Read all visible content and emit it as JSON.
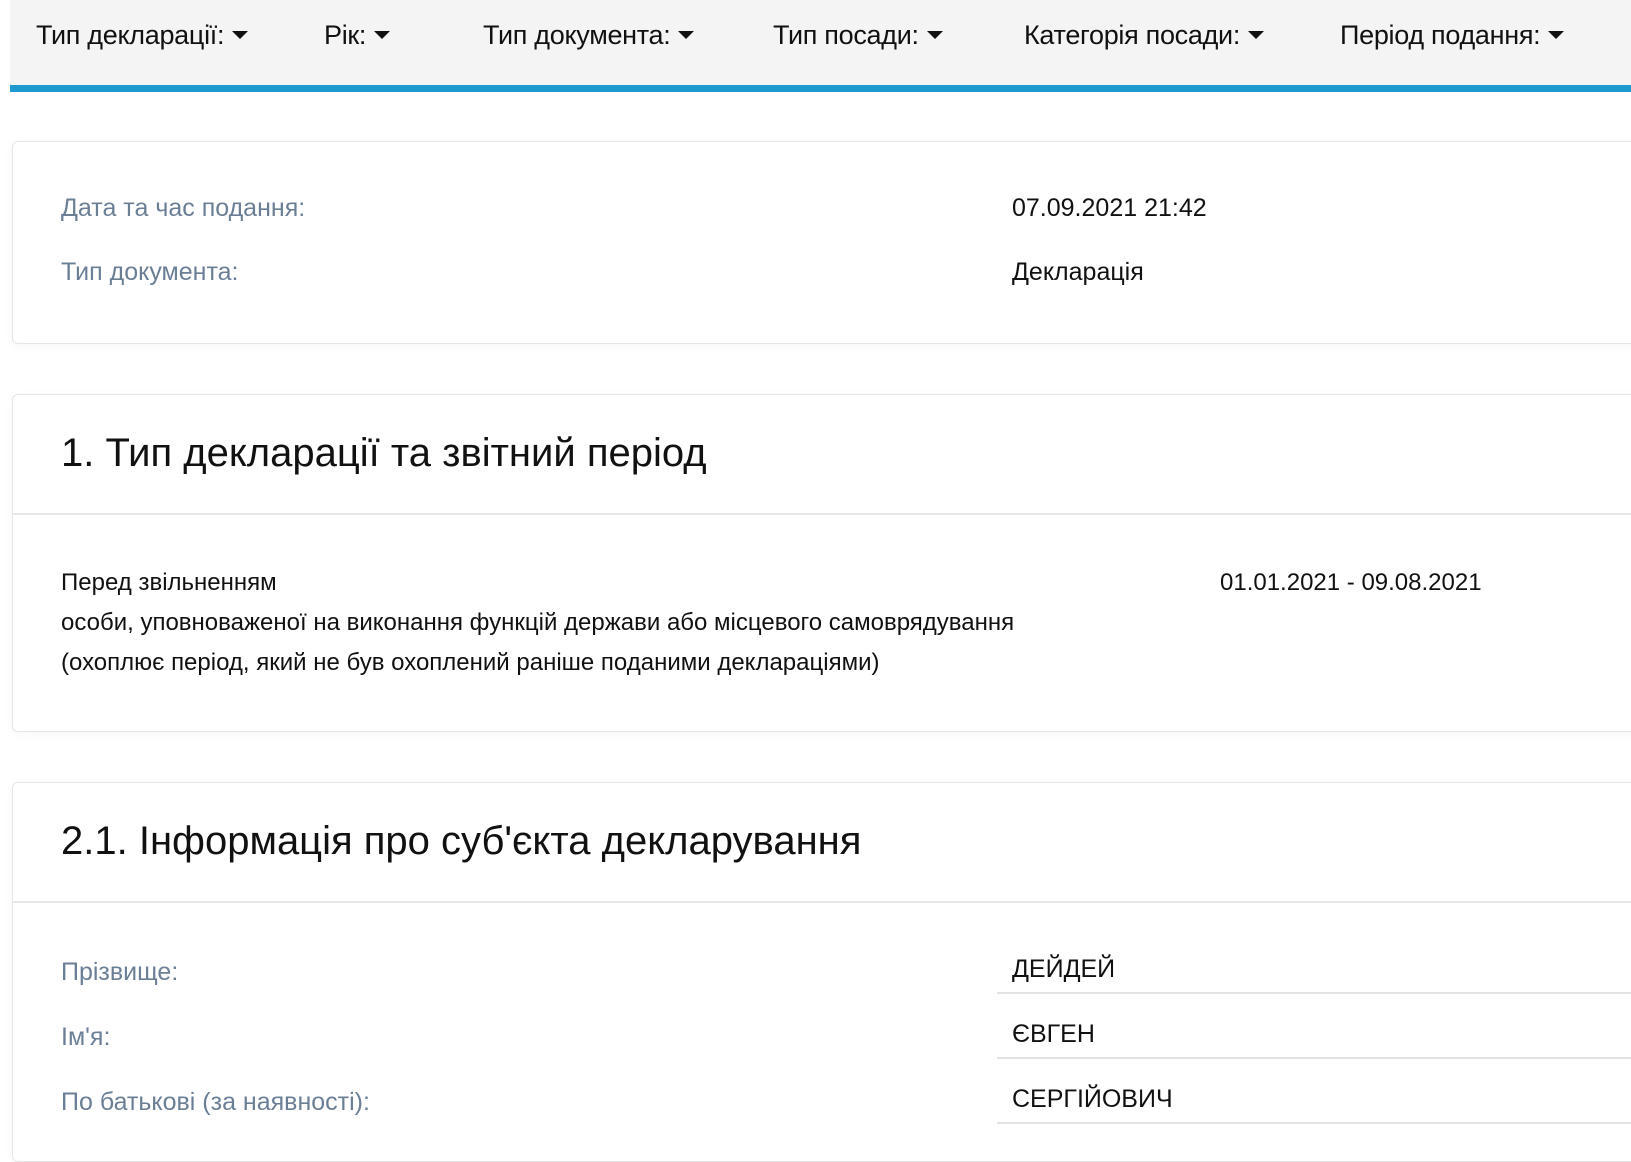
{
  "filters": [
    {
      "label": "Тип декларації:"
    },
    {
      "label": "Рік:"
    },
    {
      "label": "Тип документа:"
    },
    {
      "label": "Тип посади:"
    },
    {
      "label": "Категорія посади:"
    },
    {
      "label": "Період подання:"
    }
  ],
  "meta": {
    "submitted_label": "Дата та час подання:",
    "submitted_value": "07.09.2021 21:42",
    "doc_type_label": "Тип документа:",
    "doc_type_value": "Декларація"
  },
  "section1": {
    "title": "1. Тип декларації та звітний період",
    "line1": "Перед звільненням",
    "line2": "особи, уповноваженої на виконання функцій держави або місцевого самоврядування",
    "line3": "(охоплює період, який не був охоплений раніше поданими деклараціями)",
    "period": "01.01.2021 - 09.08.2021"
  },
  "section2": {
    "title": "2.1. Інформація про суб'єкта декларування",
    "fields": [
      {
        "label": "Прізвище:",
        "value": "ДЕЙДЕЙ"
      },
      {
        "label": "Ім'я:",
        "value": "ЄВГЕН"
      },
      {
        "label": "По батькові (за наявності):",
        "value": "СЕРГІЙОВИЧ"
      }
    ]
  }
}
